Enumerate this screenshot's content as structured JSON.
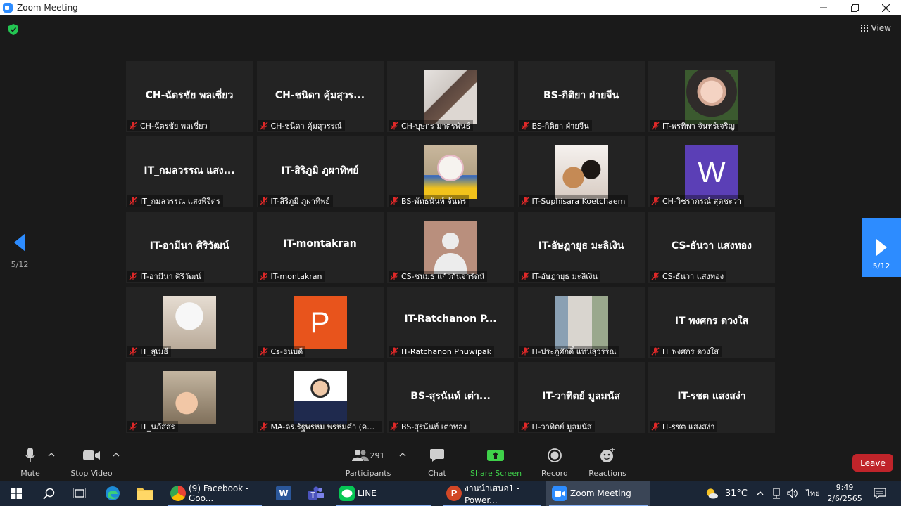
{
  "window": {
    "title": "Zoom Meeting"
  },
  "meeting": {
    "view_label": "View",
    "page_left": "5/12",
    "page_right": "5/12",
    "tiles": [
      {
        "big": "CH-ฉัตรชัย พลเชี่ยว",
        "label": "CH-ฉัตรชัย พลเชี่ยว"
      },
      {
        "big": "CH-ชนิดา คุ้มสุวร...",
        "label": "CH-ชนิดา คุ้มสุวรรณ์"
      },
      {
        "big": "",
        "label": "CH-บุษกร มาตรพันธ์"
      },
      {
        "big": "BS-กิติยา ฝ่ายจีน",
        "label": "BS-กิติยา ฝ่ายจีน"
      },
      {
        "big": "",
        "label": "IT-พรทิพา จันทร์เจริญ"
      },
      {
        "big": "IT_กมลวรรณ แสง...",
        "label": "IT_กมลวรรณ แสงพิจิตร"
      },
      {
        "big": "IT-สิริภูมิ ภูผาทิพย์",
        "label": "IT-สิริภูมิ ภูผาทิพย์"
      },
      {
        "big": "",
        "label": "BS-พัทธนันท์ จันทร"
      },
      {
        "big": "",
        "label": "IT-Suphisara Koetchaem"
      },
      {
        "big": "",
        "letter": "W",
        "label": "CH-วิชราภรณ์ สุดชะวา"
      },
      {
        "big": "IT-อามีนา ศิริวัฒน์",
        "label": "IT-อามีนา ศิริวัฒน์"
      },
      {
        "big": "IT-montakran",
        "label": "IT-montakran"
      },
      {
        "big": "",
        "label": "CS-ชนมธ แก้วกันจารัตน์"
      },
      {
        "big": "IT-อัษฎายุธ มะลิเงิน",
        "label": "IT-อัษฎายุธ มะลิเงิน"
      },
      {
        "big": "CS-ธันวา แสงทอง",
        "label": "CS-ธันวา แสงทอง"
      },
      {
        "big": "",
        "label": "IT_สุเมธี"
      },
      {
        "big": "",
        "letter": "P",
        "label": "Cs-ธนบดี"
      },
      {
        "big": "IT-Ratchanon P...",
        "label": "IT-Ratchanon Phuwipak"
      },
      {
        "big": "",
        "label": "IT-ประภูศักดิ์ แท่นสุวรรณ"
      },
      {
        "big": "IT พงศกร ดวงใส",
        "label": "IT พงศกร ดวงใส"
      },
      {
        "big": "",
        "label": "IT_นภัสสร"
      },
      {
        "big": "",
        "label": "MA-ดร.รัฐพรหม พรหมคำ (คณ..."
      },
      {
        "big": "BS-สุรนันท์   เต่า...",
        "label": "BS-สุรนันท์   เต่าทอง"
      },
      {
        "big": "IT-วาทิตย์ มูลมนัส",
        "label": "IT-วาทิตย์ มูลมนัส"
      },
      {
        "big": "IT-รชต แสงสง่า",
        "label": "IT-รชต แสงสง่า"
      }
    ]
  },
  "toolbar": {
    "mute": "Mute",
    "stop_video": "Stop Video",
    "participants": "Participants",
    "participants_count": "291",
    "chat": "Chat",
    "share_screen": "Share Screen",
    "record": "Record",
    "reactions": "Reactions",
    "leave": "Leave"
  },
  "taskbar": {
    "apps": [
      {
        "label": "(9) Facebook - Goo...",
        "icon": "chrome-icon"
      },
      {
        "label": "LINE",
        "icon": "line-icon"
      },
      {
        "label": "งานนำเสนอ1 - Power...",
        "icon": "powerpoint-icon"
      },
      {
        "label": "Zoom Meeting",
        "icon": "zoom-icon"
      }
    ],
    "word_letter": "W",
    "temperature": "31°C",
    "language": "ไทย",
    "time": "9:49",
    "date": "2/6/2565"
  },
  "colors": {
    "zoom_blue": "#2d8cff",
    "leave_red": "#c0242a",
    "share_green": "#3fd14a",
    "tile_bg": "#232323",
    "taskbar_bg": "#1b2636"
  }
}
